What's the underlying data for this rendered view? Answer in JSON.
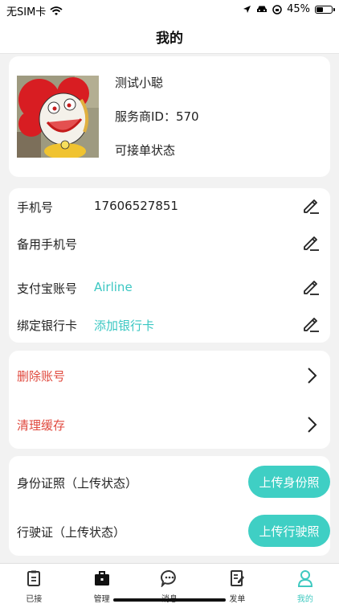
{
  "status_bar": {
    "carrier": "无SIM卡",
    "battery": "45%",
    "battery_level": 0.45
  },
  "header": {
    "title": "我的"
  },
  "profile": {
    "name": "测试小聪",
    "provider_id": "服务商ID：570",
    "status": "可接单状态"
  },
  "info": {
    "phone_label": "手机号",
    "phone_value": "17606527851",
    "backup_phone_label": "备用手机号",
    "backup_phone_value": "",
    "alipay_label": "支付宝账号",
    "alipay_value": "Airline",
    "bank_label": "绑定银行卡",
    "bank_value": "添加银行卡"
  },
  "actions": {
    "delete_account": "删除账号",
    "clear_cache": "清理缓存"
  },
  "uploads": {
    "id_label": "身份证照（上传状态）",
    "id_button": "上传身份照",
    "license_label": "行驶证（上传状态）",
    "license_button": "上传行驶照"
  },
  "tabs": [
    {
      "label": "已接",
      "icon": "clipboard-icon"
    },
    {
      "label": "管理",
      "icon": "briefcase-icon"
    },
    {
      "label": "消息",
      "icon": "message-icon"
    },
    {
      "label": "发单",
      "icon": "document-icon"
    },
    {
      "label": "我的",
      "icon": "person-icon"
    }
  ],
  "colors": {
    "accent": "#3fcfc4",
    "danger": "#e04a3f",
    "background": "#f2f2f2"
  }
}
